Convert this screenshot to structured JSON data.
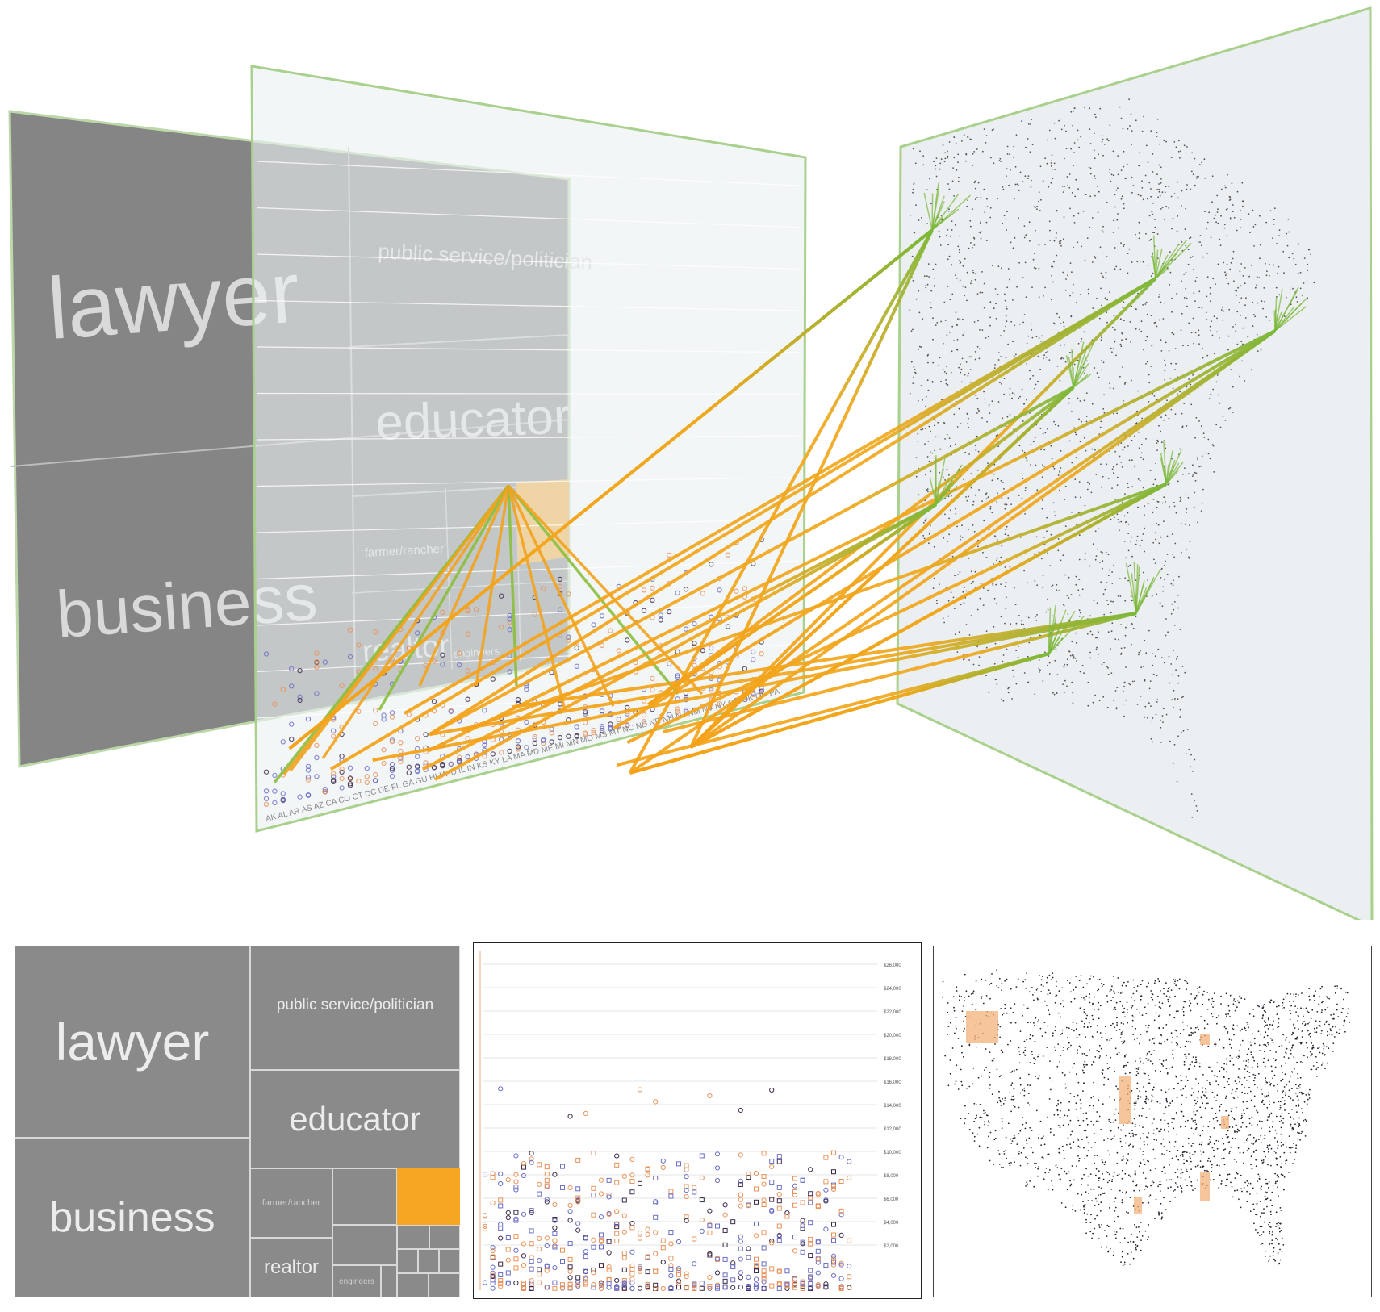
{
  "treemap": {
    "cells": [
      {
        "id": "lawyer",
        "label": "lawyer"
      },
      {
        "id": "business",
        "label": "business"
      },
      {
        "id": "public",
        "label": "public service/politician"
      },
      {
        "id": "educator",
        "label": "educator"
      },
      {
        "id": "farmer",
        "label": "farmer/rancher"
      },
      {
        "id": "realtor",
        "label": "realtor"
      },
      {
        "id": "engineers",
        "label": "engineers"
      },
      {
        "id": "highlight",
        "label": ""
      }
    ],
    "highlight_color": "#f6a623"
  },
  "scatter": {
    "y_ticks": [
      "$26,000",
      "$24,000",
      "$22,000",
      "$20,000",
      "$18,000",
      "$16,000",
      "$14,000",
      "$12,000",
      "$10,000",
      "$8,000",
      "$6,000",
      "$4,000",
      "$2,000"
    ],
    "x_labels_3d": "AK AL AR AS AZ CA CO CT DC DE FL GA GU HI IA ID IL IN KS KY LA MA MD ME MI MN MO MS MT NC ND NE NH NJ NM NV NY OH OK OR PA",
    "marker_colors": {
      "orange": "#e8925a",
      "blue": "#6b6fc4",
      "dark": "#3d2a4a"
    }
  },
  "map": {
    "dot_color": "#2a2330",
    "highlight_color": "#f4b27a"
  },
  "links": {
    "start_color": "#f5a218",
    "end_color": "#7cb83a"
  }
}
